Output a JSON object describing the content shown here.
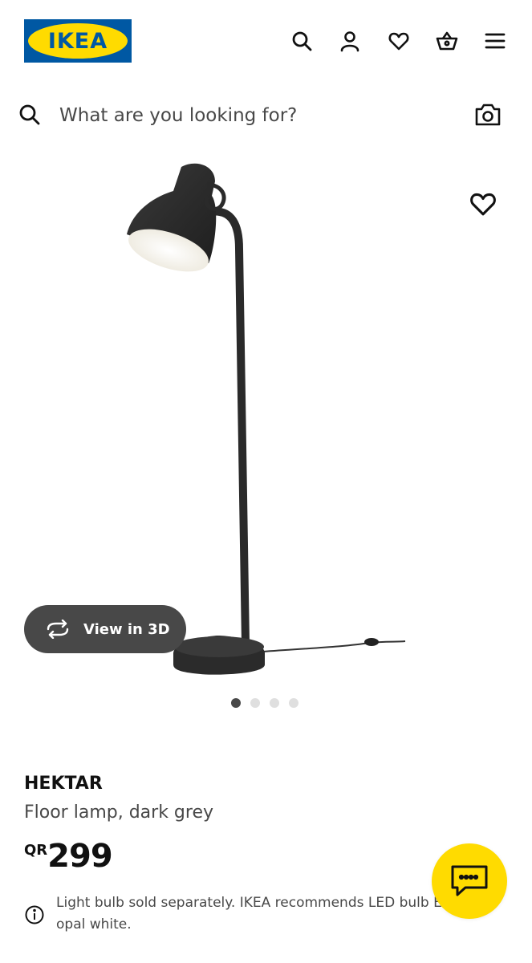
{
  "header": {
    "logo_text": "IKEA",
    "icons": [
      "search-icon",
      "account-icon",
      "heart-icon",
      "basket-icon",
      "menu-icon"
    ]
  },
  "search": {
    "placeholder": "What are you looking for?",
    "camera_icon": "camera-icon"
  },
  "gallery": {
    "view3d_label": "View in 3D",
    "slide_count": 4,
    "active_slide": 1
  },
  "product": {
    "name": "HEKTAR",
    "description": "Floor lamp, dark grey",
    "currency": "QR",
    "price": "299",
    "note": "Light bulb sold separately. IKEA recommends LED bulb E27 opal white."
  },
  "colors": {
    "brand_blue": "#0058a3",
    "brand_yellow": "#ffdb00",
    "dark_grey": "#484848"
  }
}
